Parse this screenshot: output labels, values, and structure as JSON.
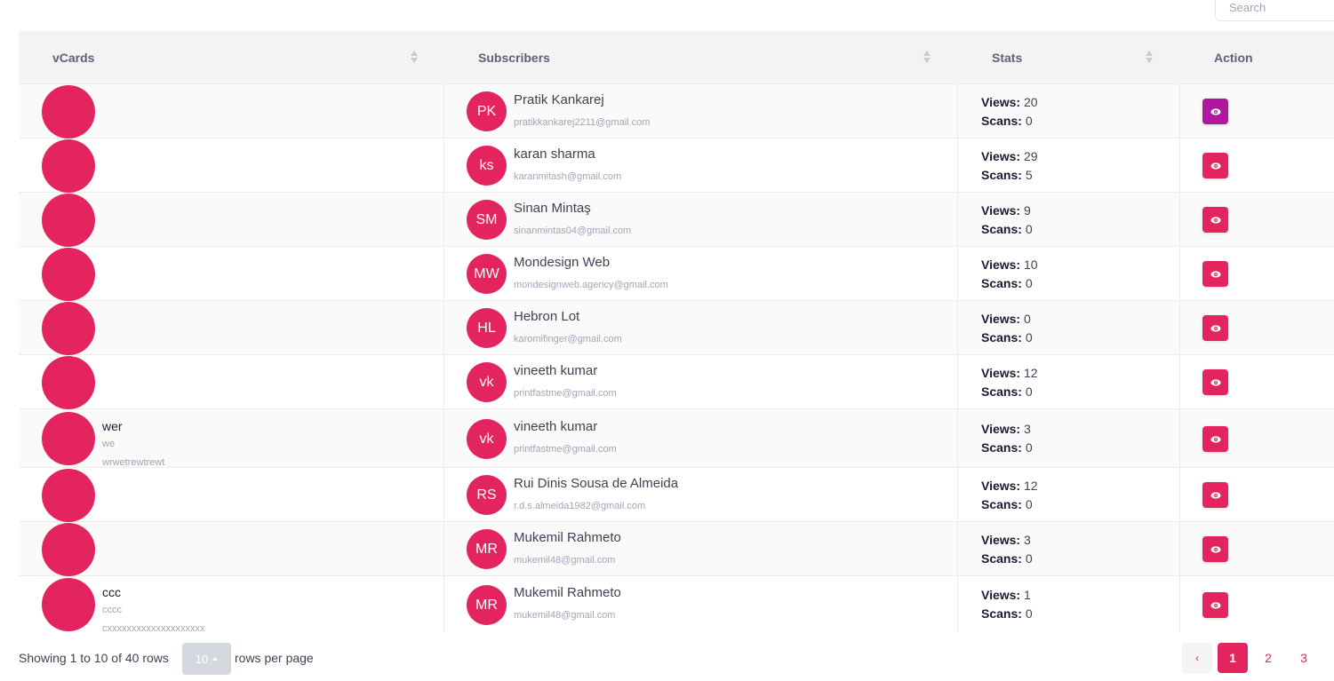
{
  "search": {
    "placeholder": "Search"
  },
  "table": {
    "columns": [
      "vCards",
      "Subscribers",
      "Stats",
      "Action"
    ],
    "stats_labels": {
      "views": "Views:",
      "scans": "Scans:"
    },
    "rows": [
      {
        "vcard": {
          "name": "",
          "line1": "",
          "line2": ""
        },
        "initials": "PK",
        "name": "Pratik Kankarej",
        "email": "pratikkankarej2211@gmail.com",
        "views": "20",
        "scans": "0",
        "active": true
      },
      {
        "vcard": {
          "name": "",
          "line1": "",
          "line2": ""
        },
        "initials": "ks",
        "name": "karan sharma",
        "email": "karanmitash@gmail.com",
        "views": "29",
        "scans": "5",
        "active": false
      },
      {
        "vcard": {
          "name": "",
          "line1": "",
          "line2": ""
        },
        "initials": "SM",
        "name": "Sinan Mintaş",
        "email": "sinanmintas04@gmail.com",
        "views": "9",
        "scans": "0",
        "active": false
      },
      {
        "vcard": {
          "name": "",
          "line1": "",
          "line2": ""
        },
        "initials": "MW",
        "name": "Mondesign Web",
        "email": "mondesignweb.agency@gmail.com",
        "views": "10",
        "scans": "0",
        "active": false
      },
      {
        "vcard": {
          "name": "",
          "line1": "",
          "line2": ""
        },
        "initials": "HL",
        "name": "Hebron Lot",
        "email": "karomifinger@gmail.com",
        "views": "0",
        "scans": "0",
        "active": false
      },
      {
        "vcard": {
          "name": "",
          "line1": "",
          "line2": ""
        },
        "initials": "vk",
        "name": "vineeth kumar",
        "email": "printfastme@gmail.com",
        "views": "12",
        "scans": "0",
        "active": false
      },
      {
        "vcard": {
          "name": "wer",
          "line1": "we",
          "line2": "wrwetrewtrewt"
        },
        "initials": "vk",
        "name": "vineeth kumar",
        "email": "printfastme@gmail.com",
        "views": "3",
        "scans": "0",
        "active": false
      },
      {
        "vcard": {
          "name": "",
          "line1": "",
          "line2": ""
        },
        "initials": "RS",
        "name": "Rui Dinis Sousa de Almeida",
        "email": "r.d.s.almeida1982@gmail.com",
        "views": "12",
        "scans": "0",
        "active": false
      },
      {
        "vcard": {
          "name": "",
          "line1": "",
          "line2": ""
        },
        "initials": "MR",
        "name": "Mukemil Rahmeto",
        "email": "mukemil48@gmail.com",
        "views": "3",
        "scans": "0",
        "active": false
      },
      {
        "vcard": {
          "name": "ccc",
          "line1": "cccc",
          "line2": "cxxxxxxxxxxxxxxxxxxxx"
        },
        "initials": "MR",
        "name": "Mukemil Rahmeto",
        "email": "mukemil48@gmail.com",
        "views": "1",
        "scans": "0",
        "active": false
      }
    ]
  },
  "footer": {
    "showing": "Showing 1 to 10 of 40 rows",
    "page_size": "10",
    "rows_per_page": "rows per page",
    "pages": [
      "1",
      "2",
      "3"
    ],
    "prev": "‹",
    "current_page": "1"
  },
  "colors": {
    "accent": "#e4245f",
    "active_action": "#b0179e"
  }
}
